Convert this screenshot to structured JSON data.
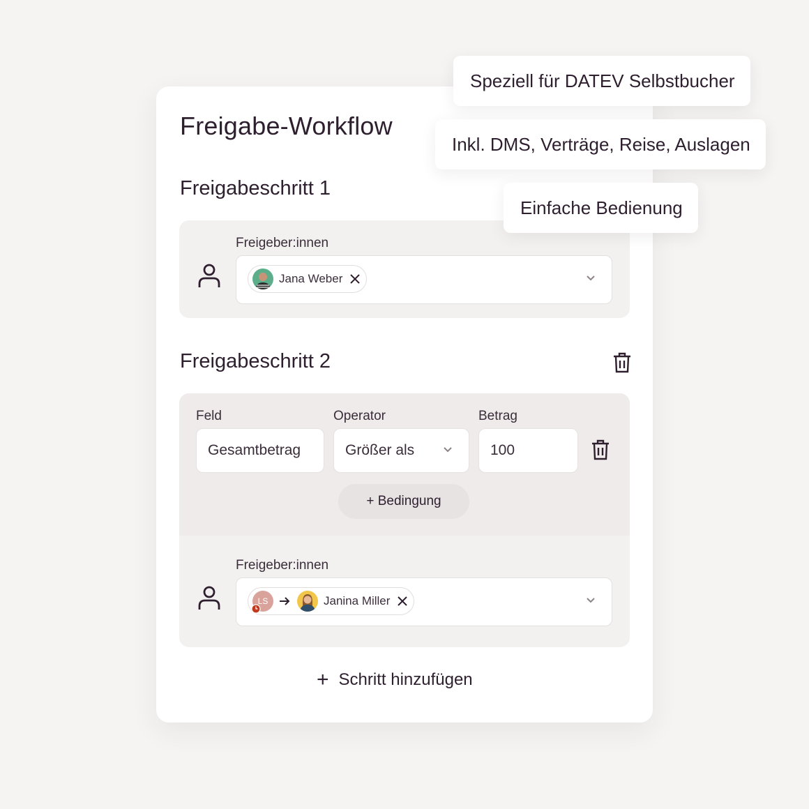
{
  "card": {
    "title": "Freigabe-Workflow",
    "step1": {
      "title": "Freigabeschritt 1",
      "approvers_label": "Freigeber:innen",
      "approver_chip": {
        "name": "Jana Weber"
      }
    },
    "step2": {
      "title": "Freigabeschritt 2",
      "condition": {
        "field_label": "Feld",
        "field_value": "Gesamtbetrag",
        "operator_label": "Operator",
        "operator_value": "Größer als",
        "amount_label": "Betrag",
        "amount_value": "100"
      },
      "add_condition_label": "+ Bedingung",
      "approvers_label": "Freigeber:innen",
      "approver_chip": {
        "substitute_initials": "LS",
        "name": "Janina Miller"
      }
    },
    "add_step_label": "Schritt hinzufügen"
  },
  "tags": [
    "Speziell für DATEV Selbstbucher",
    "Inkl. DMS, Verträge, Reise, Auslagen",
    "Einfache Bedienung"
  ],
  "colors": {
    "background": "#f5f4f2",
    "card": "#ffffff",
    "panel": "#f3f1f0",
    "text": "#2e1f2f"
  }
}
